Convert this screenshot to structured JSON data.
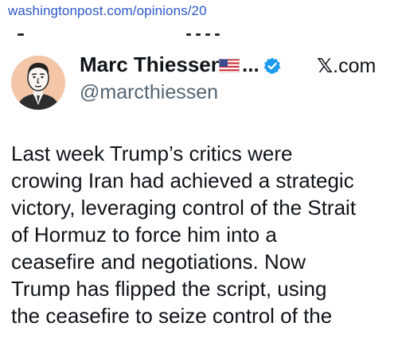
{
  "browser": {
    "url": "washingtonpost.com/opinions/20"
  },
  "tweet": {
    "author_name": "Marc Thiessen",
    "name_truncation": "...",
    "handle": "@marcthiessen",
    "source_brand_glyph": "𝕏",
    "source_brand_text": ".com",
    "text": "Last week Trump’s critics were\ncrowing Iran had achieved a strategic\nvictory, leveraging control of the Strait\nof Hormuz to force him into a\nceasefire and negotiations. Now\nTrump has flipped the script, using\nthe ceasefire to seize control of the",
    "icons": {
      "avatar": "cartoon-portrait-avatar",
      "flag": "us-flag-icon",
      "verified": "verified-badge-icon"
    }
  },
  "colors": {
    "link": "#2b56c6",
    "text": "#0f1419",
    "secondary_text": "#536471",
    "verified": "#1d9bf0",
    "avatar_bg": "#f3c6a8"
  }
}
